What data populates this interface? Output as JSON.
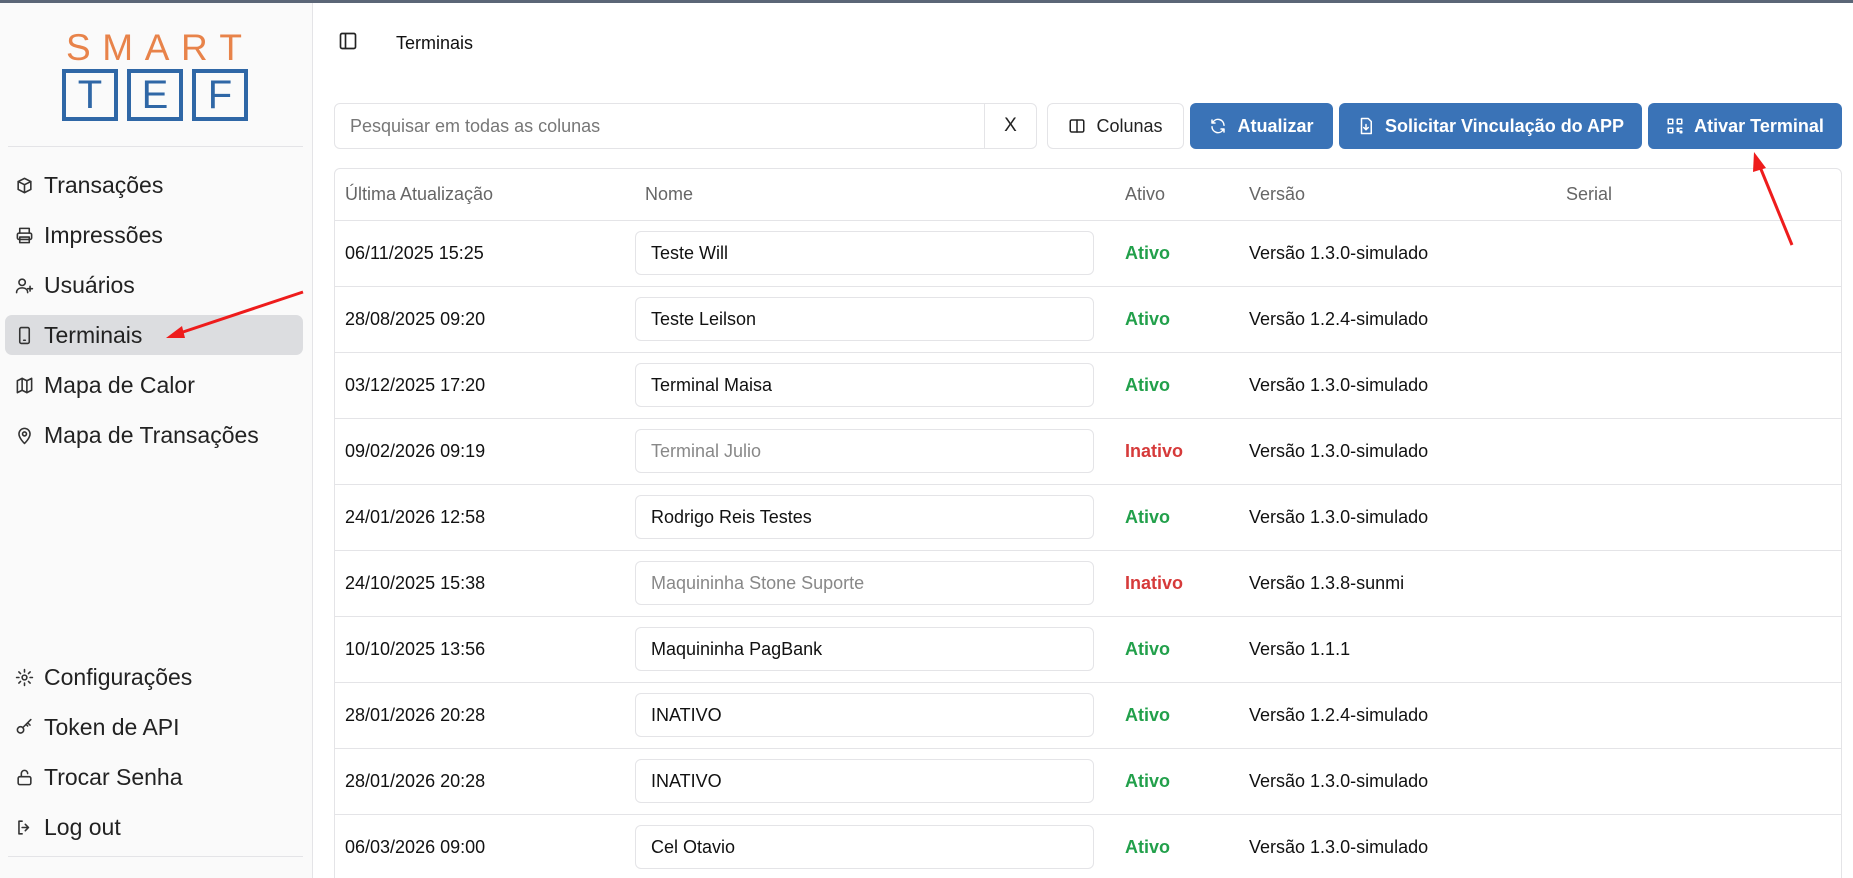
{
  "logo": {
    "smart": "SMART",
    "tef": [
      "T",
      "E",
      "F"
    ]
  },
  "sidebar": {
    "items": [
      {
        "label": "Transações",
        "icon": "box-icon"
      },
      {
        "label": "Impressões",
        "icon": "printer-icon"
      },
      {
        "label": "Usuários",
        "icon": "user-plus-icon"
      },
      {
        "label": "Terminais",
        "icon": "tablet-icon",
        "active": true
      },
      {
        "label": "Mapa de Calor",
        "icon": "map-icon"
      },
      {
        "label": "Mapa de Transações",
        "icon": "map-pin-icon"
      }
    ],
    "bottom_items": [
      {
        "label": "Configurações",
        "icon": "gear-icon"
      },
      {
        "label": "Token de API",
        "icon": "key-icon"
      },
      {
        "label": "Trocar Senha",
        "icon": "lock-open-icon"
      },
      {
        "label": "Log out",
        "icon": "log-out-icon"
      }
    ]
  },
  "header": {
    "title": "Terminais"
  },
  "toolbar": {
    "search_placeholder": "Pesquisar em todas as colunas",
    "clear_label": "X",
    "columns_label": "Colunas",
    "refresh_label": "Atualizar",
    "request_link_label": "Solicitar Vinculação do APP",
    "activate_label": "Ativar Terminal"
  },
  "table": {
    "headers": [
      "Última Atualização",
      "Nome",
      "Ativo",
      "Versão",
      "Serial"
    ],
    "rows": [
      {
        "updated": "06/11/2025 15:25",
        "name": "Teste Will",
        "status": "Ativo",
        "version": "Versão 1.3.0-simulado",
        "serial": ""
      },
      {
        "updated": "28/08/2025 09:20",
        "name": "Teste Leilson",
        "status": "Ativo",
        "version": "Versão 1.2.4-simulado",
        "serial": ""
      },
      {
        "updated": "03/12/2025 17:20",
        "name": "Terminal Maisa",
        "status": "Ativo",
        "version": "Versão 1.3.0-simulado",
        "serial": ""
      },
      {
        "updated": "09/02/2026 09:19",
        "name": "Terminal Julio",
        "status": "Inativo",
        "version": "Versão 1.3.0-simulado",
        "serial": ""
      },
      {
        "updated": "24/01/2026 12:58",
        "name": "Rodrigo Reis Testes",
        "status": "Ativo",
        "version": "Versão 1.3.0-simulado",
        "serial": ""
      },
      {
        "updated": "24/10/2025 15:38",
        "name": "Maquininha Stone Suporte",
        "status": "Inativo",
        "version": "Versão 1.3.8-sunmi",
        "serial": ""
      },
      {
        "updated": "10/10/2025 13:56",
        "name": "Maquininha PagBank",
        "status": "Ativo",
        "version": "Versão 1.1.1",
        "serial": ""
      },
      {
        "updated": "28/01/2026 20:28",
        "name": "INATIVO",
        "status": "Ativo",
        "version": "Versão 1.2.4-simulado",
        "serial": ""
      },
      {
        "updated": "28/01/2026 20:28",
        "name": "INATIVO",
        "status": "Ativo",
        "version": "Versão 1.3.0-simulado",
        "serial": ""
      },
      {
        "updated": "06/03/2026 09:00",
        "name": "Cel Otavio",
        "status": "Ativo",
        "version": "Versão 1.3.0-simulado",
        "serial": ""
      }
    ]
  },
  "colors": {
    "primary": "#3a73b7",
    "active": "#22a04b",
    "inactive": "#d63a3a",
    "logo_orange": "#e8834a",
    "logo_blue": "#2f67a6",
    "annotation": "#ee1c1c"
  }
}
